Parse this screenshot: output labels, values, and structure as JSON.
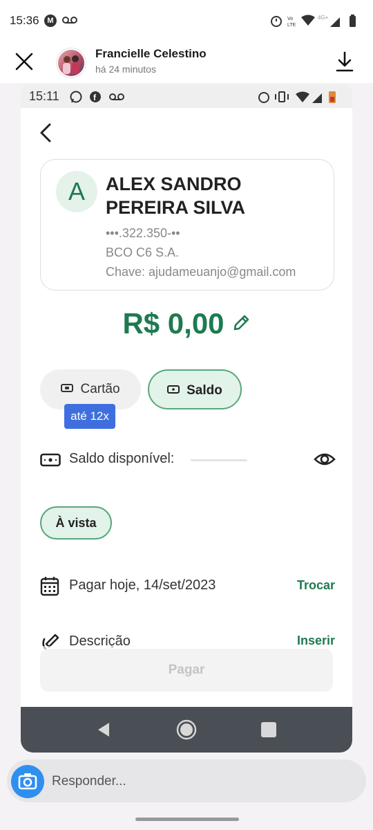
{
  "outer_status": {
    "time": "15:36"
  },
  "story": {
    "poster_name": "Francielle Celestino",
    "posted_ago": "há 24 minutos"
  },
  "inner_status": {
    "time": "15:11"
  },
  "recipient": {
    "initial": "A",
    "name": "ALEX SANDRO PEREIRA SILVA",
    "document": "•••.322.350-••",
    "bank": "BCO C6 S.A.",
    "key": "Chave: ajudameuanjo@gmail.com"
  },
  "amount": "R$ 0,00",
  "payment_methods": {
    "cartao_label": "Cartão",
    "cartao_badge": "até 12x",
    "saldo_label": "Saldo",
    "selected": "Saldo"
  },
  "balance": {
    "label": "Saldo disponível:"
  },
  "installment": {
    "label": "À vista"
  },
  "date_row": {
    "label": "Pagar hoje, 14/set/2023",
    "action": "Trocar"
  },
  "description_row": {
    "label": "Descrição",
    "action": "Inserir"
  },
  "pay_button": {
    "label": "Pagar",
    "enabled": false
  },
  "reply": {
    "placeholder": "Responder..."
  },
  "colors": {
    "brand_green": "#1e7a50",
    "badge_blue": "#3f6fde",
    "camera_blue": "#2f8ff0"
  },
  "icons": {
    "close": "close-icon",
    "download": "download-icon",
    "back": "arrow-left-icon",
    "edit": "pencil-icon",
    "wallet": "cash-icon",
    "visibility": "eye-icon",
    "calendar": "calendar-icon",
    "description": "pen-icon",
    "camera": "camera-icon"
  }
}
